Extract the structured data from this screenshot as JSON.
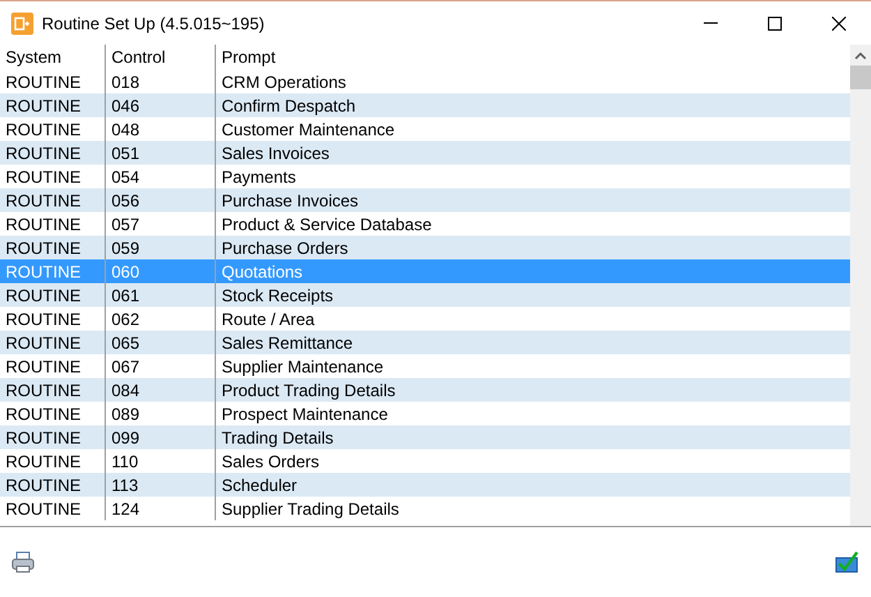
{
  "window": {
    "title": "Routine Set Up (4.5.015~195)"
  },
  "table": {
    "columns": [
      "System",
      "Control",
      "Prompt"
    ],
    "rows": [
      {
        "cells": [
          "ROUTINE",
          "018",
          "CRM Operations"
        ],
        "selected": false
      },
      {
        "cells": [
          "ROUTINE",
          "046",
          "Confirm Despatch"
        ],
        "selected": false
      },
      {
        "cells": [
          "ROUTINE",
          "048",
          "Customer Maintenance"
        ],
        "selected": false
      },
      {
        "cells": [
          "ROUTINE",
          "051",
          "Sales Invoices"
        ],
        "selected": false
      },
      {
        "cells": [
          "ROUTINE",
          "054",
          "Payments"
        ],
        "selected": false
      },
      {
        "cells": [
          "ROUTINE",
          "056",
          "Purchase Invoices"
        ],
        "selected": false
      },
      {
        "cells": [
          "ROUTINE",
          "057",
          "Product & Service Database"
        ],
        "selected": false
      },
      {
        "cells": [
          "ROUTINE",
          "059",
          "Purchase Orders"
        ],
        "selected": false
      },
      {
        "cells": [
          "ROUTINE",
          "060",
          "Quotations"
        ],
        "selected": true
      },
      {
        "cells": [
          "ROUTINE",
          "061",
          "Stock Receipts"
        ],
        "selected": false
      },
      {
        "cells": [
          "ROUTINE",
          "062",
          "Route / Area"
        ],
        "selected": false
      },
      {
        "cells": [
          "ROUTINE",
          "065",
          "Sales Remittance"
        ],
        "selected": false
      },
      {
        "cells": [
          "ROUTINE",
          "067",
          "Supplier Maintenance"
        ],
        "selected": false
      },
      {
        "cells": [
          "ROUTINE",
          "084",
          "Product Trading Details"
        ],
        "selected": false
      },
      {
        "cells": [
          "ROUTINE",
          "089",
          "Prospect Maintenance"
        ],
        "selected": false
      },
      {
        "cells": [
          "ROUTINE",
          "099",
          "Trading Details"
        ],
        "selected": false
      },
      {
        "cells": [
          "ROUTINE",
          "110",
          "Sales Orders"
        ],
        "selected": false
      },
      {
        "cells": [
          "ROUTINE",
          "113",
          "Scheduler"
        ],
        "selected": false
      },
      {
        "cells": [
          "ROUTINE",
          "124",
          "Supplier Trading Details"
        ],
        "selected": false
      }
    ]
  }
}
